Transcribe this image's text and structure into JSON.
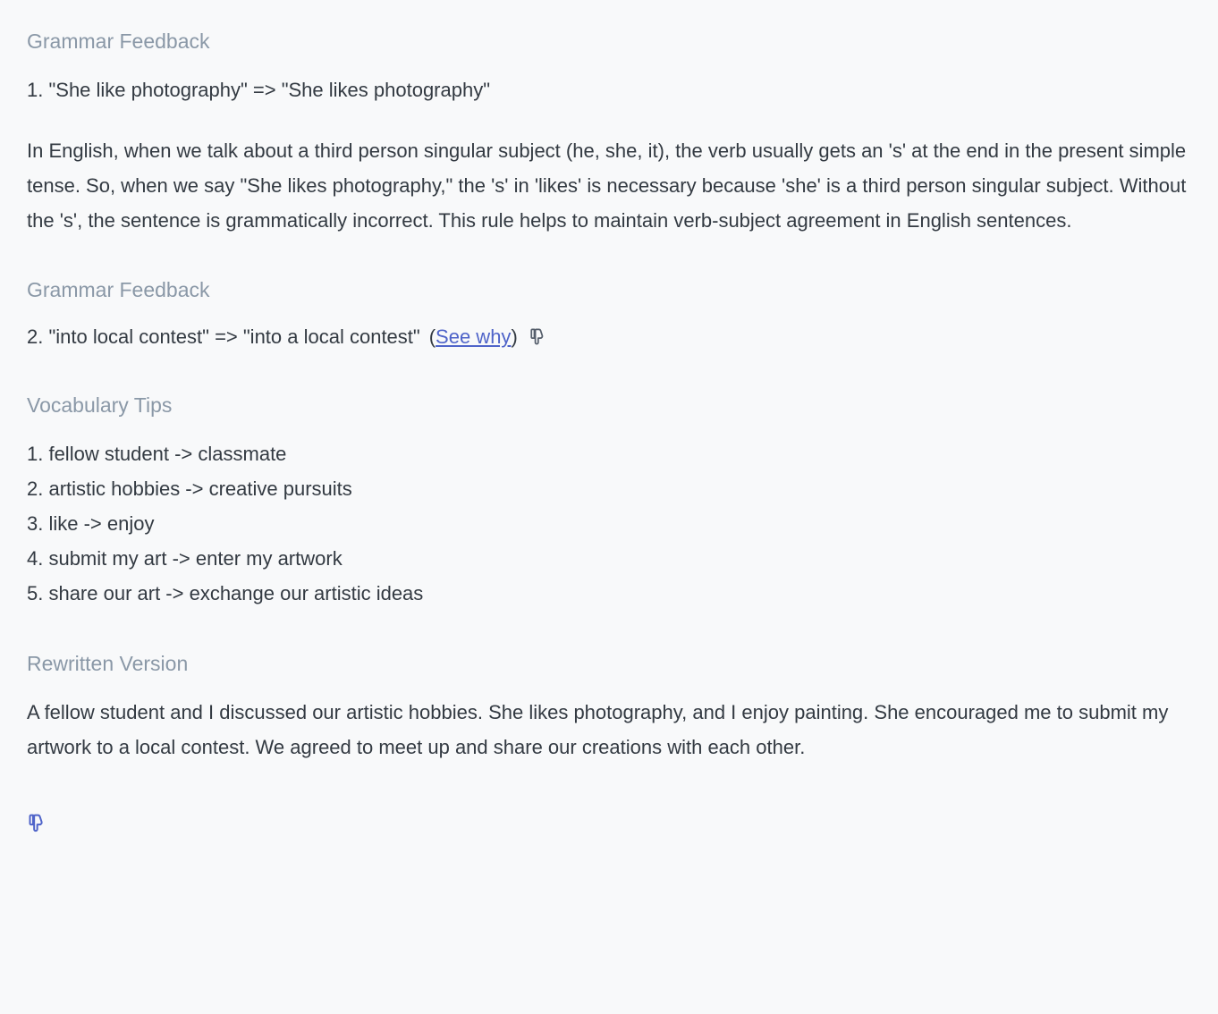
{
  "grammar1": {
    "heading": "Grammar Feedback",
    "item": "1. \"She like photography\" => \"She likes photography\"",
    "explain": "In English, when we talk about a third person singular subject (he, she, it), the verb usually gets an 's' at the end in the present simple tense. So, when we say \"She likes photography,\" the 's' in 'likes' is necessary because 'she' is a third person singular subject. Without the 's', the sentence is grammatically incorrect. This rule helps to maintain verb-subject agreement in English sentences."
  },
  "grammar2": {
    "heading": "Grammar Feedback",
    "item": "2. \"into local contest\" => \"into a local contest\"",
    "see_why": "See why"
  },
  "vocab": {
    "heading": "Vocabulary Tips",
    "items": [
      "1. fellow student -> classmate",
      "2. artistic hobbies -> creative pursuits",
      "3. like -> enjoy",
      "4. submit my art -> enter my artwork",
      "5. share our art -> exchange our artistic ideas"
    ]
  },
  "rewrite": {
    "heading": "Rewritten Version",
    "text": "A fellow student and I discussed our artistic hobbies. She likes photography, and I enjoy painting. She encouraged me to submit my artwork to a local contest. We agreed to meet up and share our creations with each other."
  }
}
